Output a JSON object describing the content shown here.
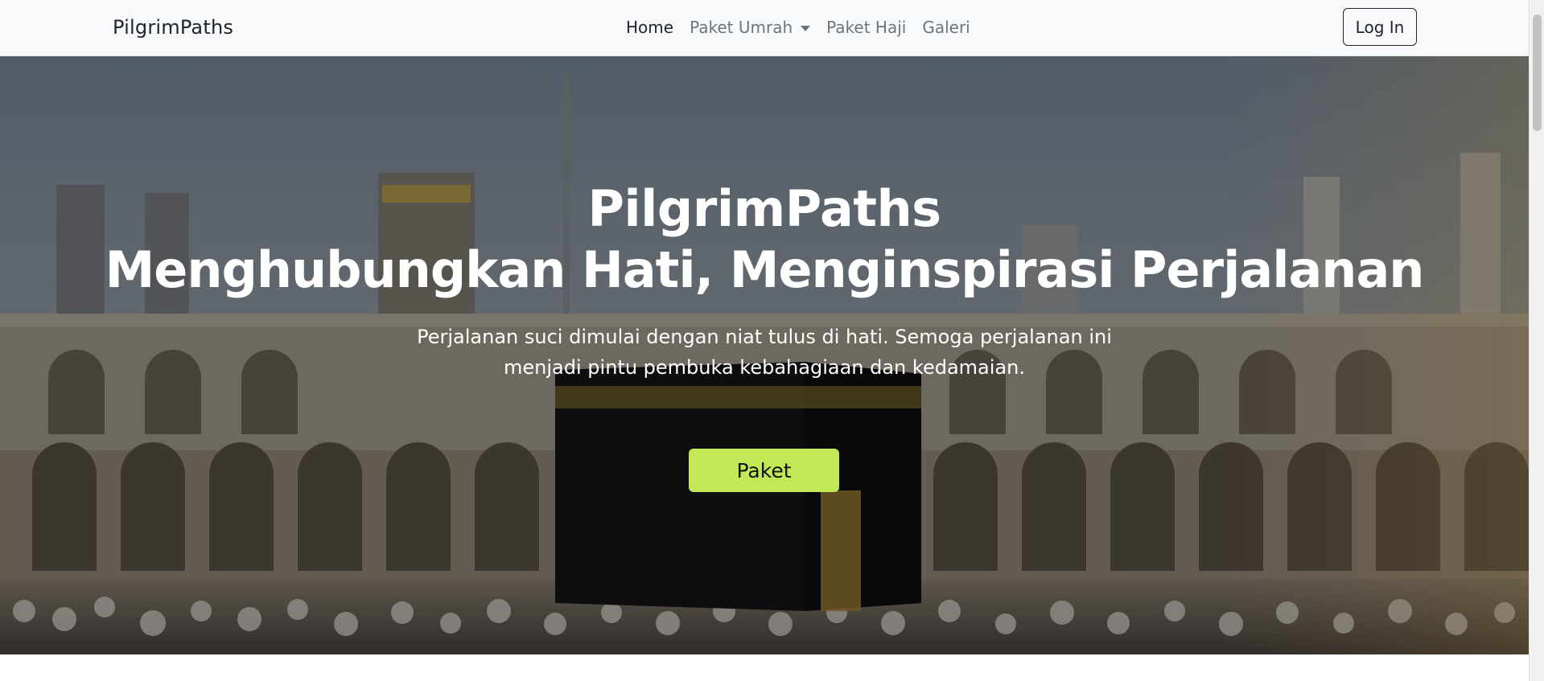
{
  "navbar": {
    "brand": "PilgrimPaths",
    "links": [
      {
        "label": "Home",
        "active": true
      },
      {
        "label": "Paket Umrah",
        "dropdown": true
      },
      {
        "label": "Paket Haji"
      },
      {
        "label": "Galeri"
      }
    ],
    "login_label": "Log In"
  },
  "hero": {
    "title": "PilgrimPaths",
    "subtitle": "Menghubungkan Hati, Menginspirasi Perjalanan",
    "description": "Perjalanan suci dimulai dengan niat tulus di hati. Semoga perjalanan ini menjadi pintu pembuka kebahagiaan dan kedamaian.",
    "button_label": "Paket",
    "button_color": "#c2e856"
  },
  "colors": {
    "navbar_bg": "#f8f9fa",
    "text_dark": "#212529",
    "text_muted": "#6c757d"
  },
  "icons": {
    "dropdown": "caret-down-icon"
  }
}
